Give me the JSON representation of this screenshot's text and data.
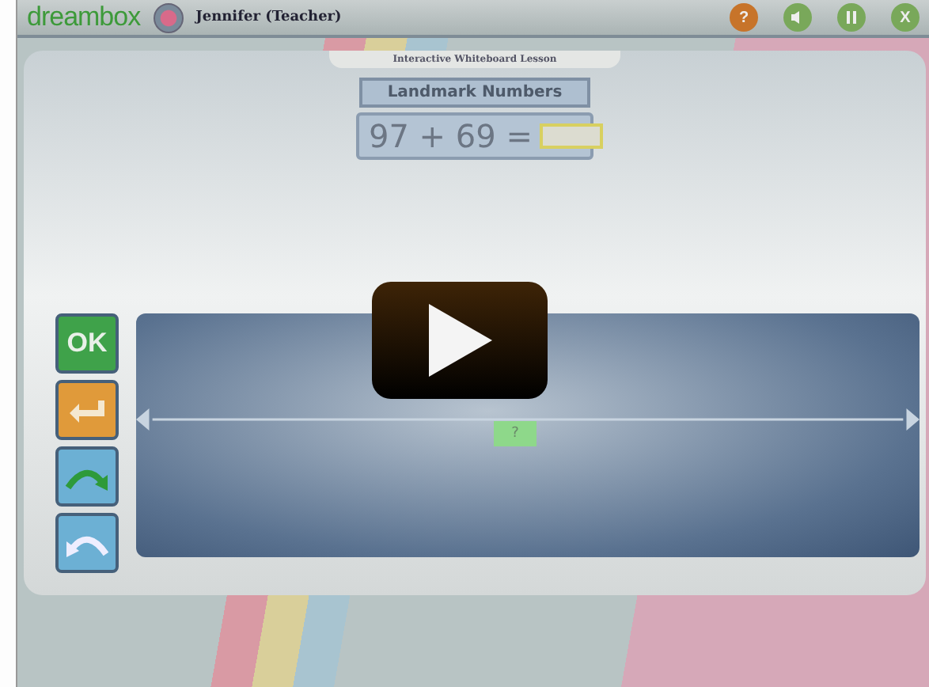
{
  "app": {
    "logo": "dreambox",
    "user": "Jennifer (Teacher)",
    "controls": [
      {
        "kind": "help",
        "label": "?"
      },
      {
        "kind": "sound"
      },
      {
        "kind": "pause"
      },
      {
        "kind": "close",
        "label": "X"
      }
    ]
  },
  "lesson": {
    "header": "Interactive Whiteboard Lesson",
    "title": "Landmark Numbers",
    "equation": "97 + 69 =",
    "tools": [
      {
        "kind": "ok",
        "label": "OK"
      },
      {
        "kind": "back"
      },
      {
        "kind": "redo"
      },
      {
        "kind": "undo"
      }
    ],
    "number_line": {
      "marker": "?"
    }
  },
  "player": {
    "play_button": true
  }
}
